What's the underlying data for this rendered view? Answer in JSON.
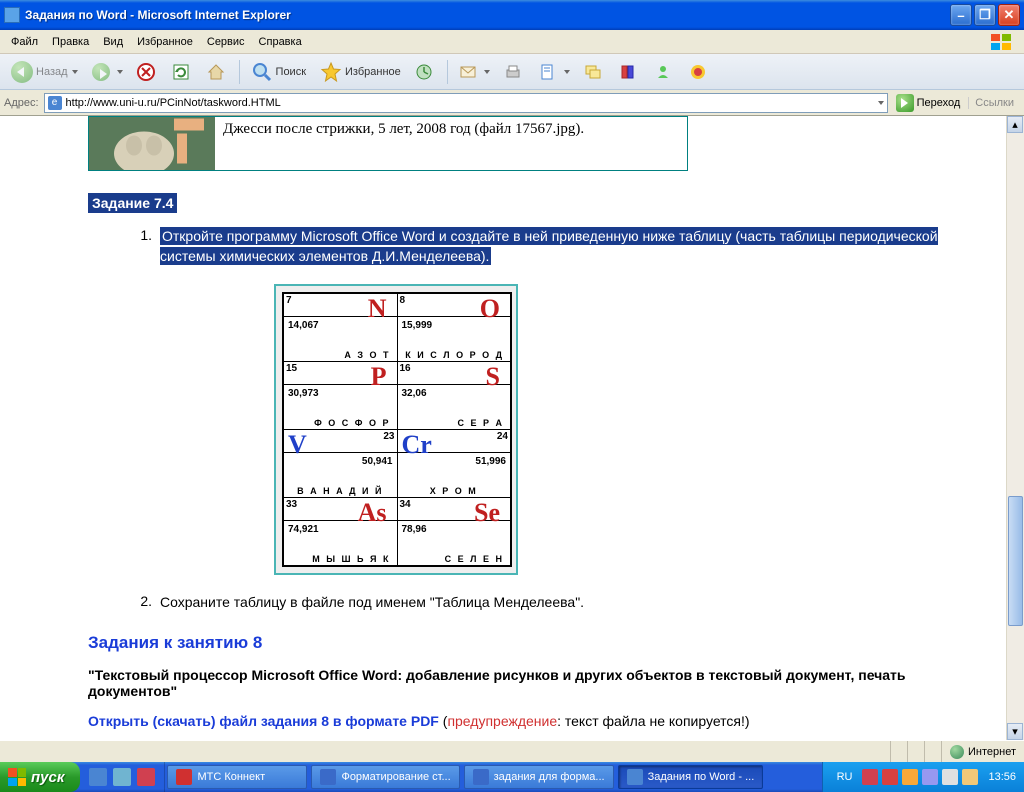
{
  "window": {
    "title": "Задания по Word - Microsoft Internet Explorer"
  },
  "menu": {
    "file": "Файл",
    "edit": "Правка",
    "view": "Вид",
    "favorites": "Избранное",
    "tools": "Сервис",
    "help": "Справка"
  },
  "toolbar": {
    "back": "Назад",
    "search": "Поиск",
    "favorites": "Избранное"
  },
  "address": {
    "label": "Адрес:",
    "url": "http://www.uni-u.ru/PCinNot/taskword.HTML",
    "go": "Переход",
    "links": "Ссылки"
  },
  "content": {
    "caption_top": "Джесси после стрижки, 5 лет, 2008 год (файл 17567.jpg).",
    "task74_heading": "Задание 7.4",
    "task74_item1_num": "1.",
    "task74_item1_text": "Откройте программу Microsoft Office Word и создайте в ней приведенную ниже таблицу (часть таблицы периодической системы химических элементов Д.И.Менделеева).",
    "task74_item2_num": "2.",
    "task74_item2_text": "Сохраните таблицу в файле под именем \"Таблица Менделеева\".",
    "section8_heading": "Задания к занятию 8",
    "section8_desc": "\"Текстовый процессор Microsoft Office Word: добавление рисунков и других объектов в текстовый документ, печать документов\"",
    "pdf_blue": "Открыть (скачать) файл задания 8 в формате PDF",
    "pdf_red": "предупреждение",
    "pdf_rest": ": текст файла не копируется!)",
    "periodic": [
      {
        "num": "7",
        "sym": "N",
        "mass": "14,067",
        "name": "АЗОТ",
        "side": "r"
      },
      {
        "num": "8",
        "sym": "O",
        "mass": "15,999",
        "name": "КИСЛОРОД",
        "side": "r"
      },
      {
        "num": "15",
        "sym": "P",
        "mass": "30,973",
        "name": "ФОСФОР",
        "side": "r"
      },
      {
        "num": "16",
        "sym": "S",
        "mass": "32,06",
        "name": "СЕРА",
        "side": "r"
      },
      {
        "num": "23",
        "sym": "V",
        "mass": "50,941",
        "name": "ВАНАДИЙ",
        "side": "b"
      },
      {
        "num": "24",
        "sym": "Cr",
        "mass": "51,996",
        "name": "ХРОМ",
        "side": "b"
      },
      {
        "num": "33",
        "sym": "As",
        "mass": "74,921",
        "name": "МЫШЬЯК",
        "side": "r"
      },
      {
        "num": "34",
        "sym": "Se",
        "mass": "78,96",
        "name": "СЕЛЕН",
        "side": "r"
      }
    ]
  },
  "status": {
    "internet": "Интернет"
  },
  "taskbar": {
    "start": "пуск",
    "items": [
      {
        "label": "МТС Коннект",
        "active": false,
        "color": "#d03030"
      },
      {
        "label": "Форматирование ст...",
        "active": false,
        "color": "#3a6ac8"
      },
      {
        "label": "задания для форма...",
        "active": false,
        "color": "#3a6ac8"
      },
      {
        "label": "Задания по Word - ...",
        "active": true,
        "color": "#4a85d2"
      }
    ],
    "lang": "RU",
    "clock": "13:56"
  }
}
